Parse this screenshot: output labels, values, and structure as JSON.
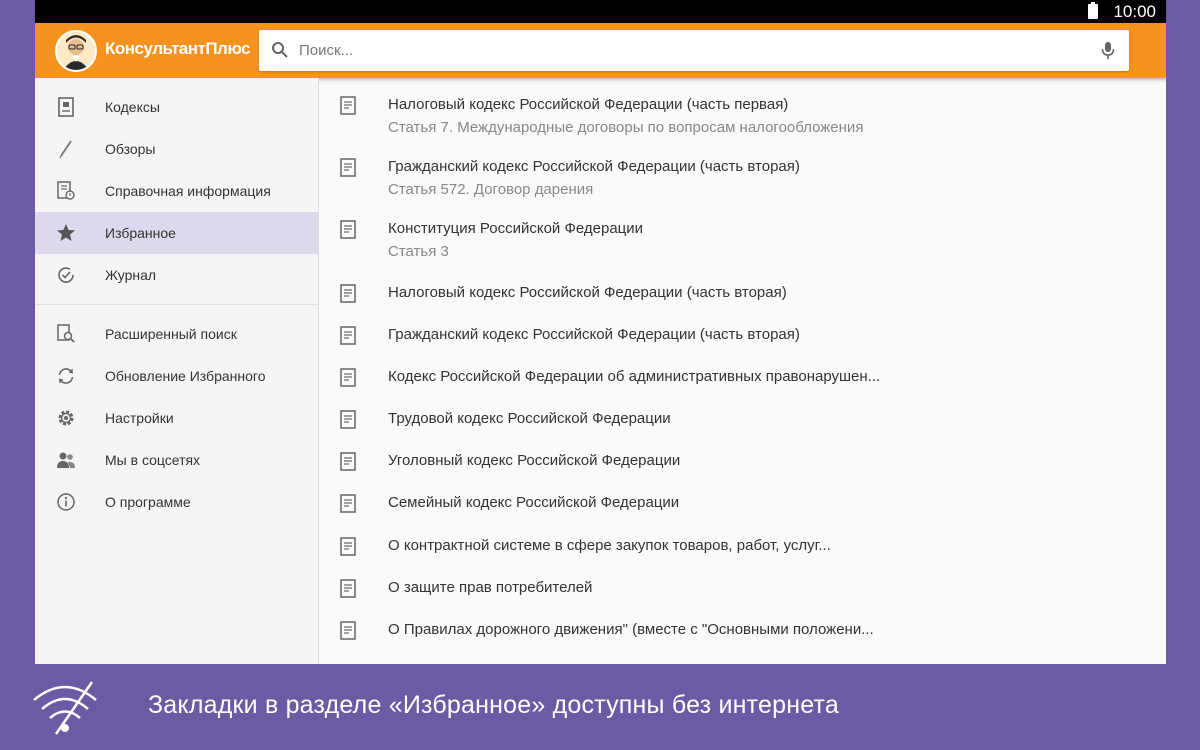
{
  "status": {
    "time": "10:00"
  },
  "app": {
    "logo_text": "КонсультантПлюс"
  },
  "search": {
    "placeholder": "Поиск..."
  },
  "colors": {
    "accent": "#f6931e",
    "selected": "#ddd8ee",
    "banner": "#6c5ba4"
  },
  "sidebar": {
    "primary": [
      {
        "label": "Кодексы",
        "icon": "codex-icon"
      },
      {
        "label": "Обзоры",
        "icon": "pencil-icon"
      },
      {
        "label": "Справочная информация",
        "icon": "reference-icon"
      },
      {
        "label": "Избранное",
        "icon": "star-icon",
        "selected": true
      },
      {
        "label": "Журнал",
        "icon": "history-icon"
      }
    ],
    "secondary": [
      {
        "label": "Расширенный поиск",
        "icon": "advanced-search-icon"
      },
      {
        "label": "Обновление Избранного",
        "icon": "refresh-icon"
      },
      {
        "label": "Настройки",
        "icon": "gear-icon"
      },
      {
        "label": "Мы в соцсетях",
        "icon": "people-icon"
      },
      {
        "label": "О программе",
        "icon": "info-icon"
      }
    ]
  },
  "favorites": [
    {
      "title": "Налоговый кодекс Российской Федерации (часть первая)",
      "subtitle": "Статья 7. Международные договоры по вопросам налогообложения"
    },
    {
      "title": "Гражданский кодекс Российской Федерации (часть вторая)",
      "subtitle": "Статья 572. Договор дарения"
    },
    {
      "title": "Конституция Российской Федерации",
      "subtitle": "Статья 3"
    },
    {
      "title": "Налоговый кодекс Российской Федерации (часть вторая)"
    },
    {
      "title": "Гражданский кодекс Российской Федерации (часть вторая)"
    },
    {
      "title": "Кодекс Российской Федерации об административных правонарушен..."
    },
    {
      "title": "Трудовой кодекс Российской Федерации"
    },
    {
      "title": "Уголовный кодекс Российской Федерации"
    },
    {
      "title": "Семейный кодекс Российской Федерации"
    },
    {
      "title": "О контрактной системе в сфере закупок товаров, работ, услуг..."
    },
    {
      "title": "О защите прав потребителей"
    },
    {
      "title": "О Правилах дорожного движения\" (вместе с \"Основными положени..."
    }
  ],
  "banner": {
    "message": "Закладки в разделе «Избранное» доступны без интернета"
  }
}
